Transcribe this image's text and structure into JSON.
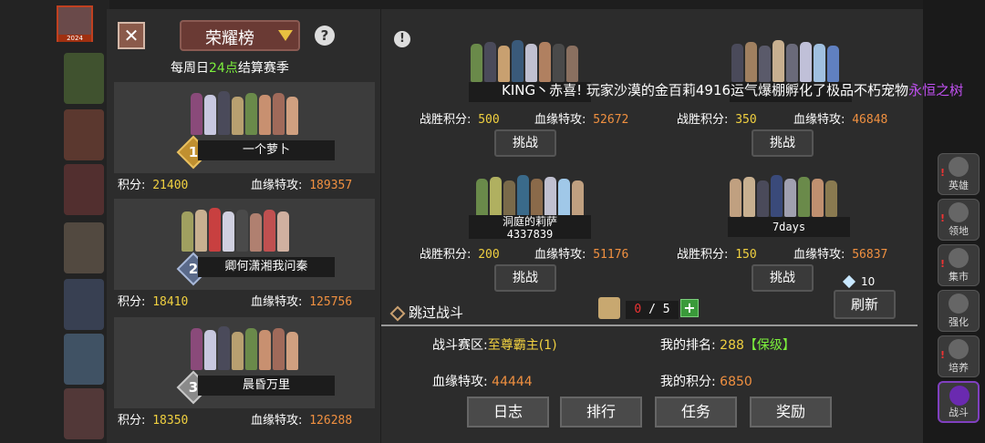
{
  "player": {
    "avatar_level": "2024"
  },
  "side_menu": [
    {
      "label": "英雄",
      "alert": true
    },
    {
      "label": "领地",
      "alert": true
    },
    {
      "label": "集市",
      "alert": true
    },
    {
      "label": "强化",
      "alert": false
    },
    {
      "label": "培养",
      "alert": true
    },
    {
      "label": "战斗",
      "alert": false
    }
  ],
  "leaderboard": {
    "close_icon": "close-x-icon",
    "title": "荣耀榜",
    "help": "?",
    "season_prefix": "每周日",
    "season_highlight": "24点",
    "season_suffix": "结算赛季",
    "entries": [
      {
        "rank": "1",
        "name": "一个萝卜",
        "score_label": "积分:",
        "score": "21400",
        "power_label": "血缘特攻:",
        "power": "189357"
      },
      {
        "rank": "2",
        "name": "卿何潇湘我问秦",
        "score_label": "积分:",
        "score": "18410",
        "power_label": "血缘特攻:",
        "power": "125756"
      },
      {
        "rank": "3",
        "name": "晨昏万里",
        "score_label": "积分:",
        "score": "18350",
        "power_label": "血缘特攻:",
        "power": "126288"
      }
    ]
  },
  "arena": {
    "alert_icon": "!",
    "marquee": {
      "prefix": "KING丶赤喜! 玩家沙漠的金百莉4916运气爆棚孵化了极品不朽宠物",
      "highlight": "永恒之树"
    },
    "opponents": [
      {
        "name": "",
        "name2": "",
        "wins_label": "战胜积分:",
        "wins": "500",
        "power_label": "血缘特攻:",
        "power": "52672",
        "button": "挑战"
      },
      {
        "name": "",
        "name2": "",
        "wins_label": "战胜积分:",
        "wins": "350",
        "power_label": "血缘特攻:",
        "power": "46848",
        "button": "挑战"
      },
      {
        "name": "洞庭的莉萨",
        "name2": "4337839",
        "wins_label": "战胜积分:",
        "wins": "200",
        "power_label": "血缘特攻:",
        "power": "51176",
        "button": "挑战"
      },
      {
        "name": "7days",
        "name2": "",
        "wins_label": "战胜积分:",
        "wins": "150",
        "power_label": "血缘特攻:",
        "power": "56837",
        "button": "挑战"
      }
    ],
    "skip_label": "跳过战斗",
    "tickets": {
      "current": "0",
      "sep": "/",
      "max": "5",
      "plus": "+"
    },
    "gems": "10",
    "refresh_label": "刷新",
    "info": {
      "zone_label": "战斗赛区:",
      "zone_value": "至尊霸主(1)",
      "rank_label": "我的排名:",
      "rank_value": "288",
      "rank_tag": "【保级】",
      "power_label": "血缘特攻:",
      "power_value": "44444",
      "score_label": "我的积分:",
      "score_value": "6850"
    },
    "bottom_buttons": [
      "日志",
      "排行",
      "任务",
      "奖励"
    ]
  },
  "colors": {
    "yellow": "#f0d040",
    "orange": "#f09040",
    "green": "#7cf03c",
    "purple": "#c050f0"
  }
}
